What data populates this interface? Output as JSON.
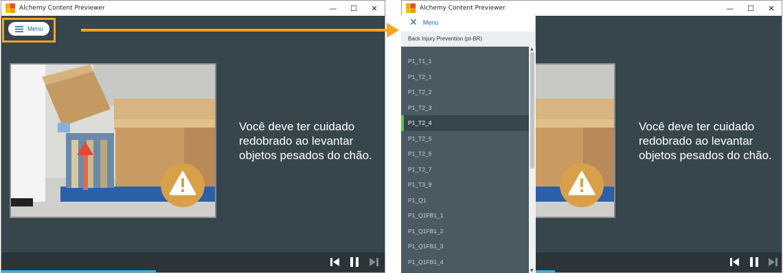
{
  "app": {
    "title": "Alchemy Content Previewer"
  },
  "window_controls": {
    "minimize": "—",
    "maximize": "☐",
    "close": "✕"
  },
  "menu_button": {
    "label": "Menu"
  },
  "menu_panel": {
    "close_label": "Menu",
    "course_title": "Back Injury Prevention (pt-BR)",
    "items": [
      {
        "label": "P1_T1_1"
      },
      {
        "label": "P1_T2_1"
      },
      {
        "label": "P1_T2_2"
      },
      {
        "label": "P1_T2_3"
      },
      {
        "label": "P1_T2_4",
        "active": true
      },
      {
        "label": "P1_T2_5"
      },
      {
        "label": "P1_T2_6"
      },
      {
        "label": "P1_T2_7"
      },
      {
        "label": "P1_T3_9"
      },
      {
        "label": "P1_Q1"
      },
      {
        "label": "P1_Q1FB1_1"
      },
      {
        "label": "P1_Q1FB1_2"
      },
      {
        "label": "P1_Q1FB1_3"
      },
      {
        "label": "P1_Q1FB1_4"
      }
    ]
  },
  "slide": {
    "text": "Você deve ter cuidado redobrado ao levantar objetos pesados do chão."
  },
  "colors": {
    "content_bg": "#37454c",
    "accent_orange": "#f5a623",
    "menu_blue": "#1d6aa8",
    "active_marker": "#4cd137",
    "progress": "#29b6f6"
  },
  "icons": {
    "app": "alchemy-logo-icon",
    "menu": "hamburger-icon",
    "close": "close-icon",
    "warning": "warning-icon",
    "previous": "skip-back-icon",
    "pause": "pause-icon",
    "next": "skip-forward-icon"
  }
}
